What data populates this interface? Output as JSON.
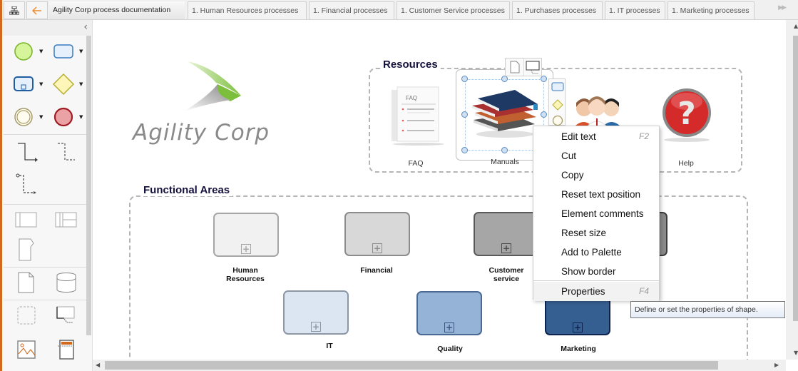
{
  "tabbar": {
    "home_icon": "diagram-tree-icon",
    "back_icon": "arrow-left-icon",
    "tabs": [
      {
        "label": "Agility Corp process documentation",
        "active": true
      },
      {
        "label": "1. Human Resources processes",
        "active": false
      },
      {
        "label": "1. Financial processes",
        "active": false
      },
      {
        "label": "1. Customer Service processes",
        "active": false
      },
      {
        "label": "1. Purchases processes",
        "active": false
      },
      {
        "label": "1. IT processes",
        "active": false
      },
      {
        "label": "1. Marketing processes",
        "active": false
      }
    ],
    "more_icon": "double-chevron-right-icon"
  },
  "palette": {
    "collapse_icon": "chevron-left-icon",
    "items": [
      "start-event",
      "task",
      "subprocess",
      "gateway",
      "intermediate-event",
      "end-event",
      "sequence-flow",
      "message-flow",
      "association",
      "pool",
      "lane-pool",
      "off-page-connector",
      "document",
      "data-store",
      "group",
      "annotation",
      "image",
      "header"
    ]
  },
  "canvas": {
    "logo": {
      "text": "Agility Corp",
      "accent": "#7cbf3c"
    },
    "resources": {
      "title": "Resources",
      "items": [
        {
          "label": "FAQ",
          "icon": "faq-document-icon"
        },
        {
          "label": "Manuals",
          "icon": "books-icon",
          "selected": true
        },
        {
          "label": "",
          "icon": "people-group-icon"
        },
        {
          "label": "Help",
          "icon": "help-question-icon"
        }
      ]
    },
    "functional_areas": {
      "title": "Functional Areas",
      "items": [
        {
          "label_lines": [
            "Human",
            "Resources"
          ],
          "fill": "#f1f1f1",
          "border": "#a6a6a6",
          "plus": "#a6a6a6"
        },
        {
          "label_lines": [
            "Financial",
            ""
          ],
          "fill": "#d8d8d8",
          "border": "#8c8c8c",
          "plus": "#8c8c8c"
        },
        {
          "label_lines": [
            "Customer",
            "service"
          ],
          "fill": "#a6a6a6",
          "border": "#5a5a5a",
          "plus": "#4a4a4a"
        },
        {
          "label_lines": [
            "",
            ""
          ],
          "fill": "#8a8a8a",
          "border": "#3d3d3d",
          "plus": "#333333"
        },
        {
          "label_lines": [
            "IT",
            ""
          ],
          "fill": "#dce6f2",
          "border": "#8c97a6",
          "plus": "#8c97a6"
        },
        {
          "label_lines": [
            "Quality",
            ""
          ],
          "fill": "#95b3d7",
          "border": "#4a6a94",
          "plus": "#3a5580"
        },
        {
          "label_lines": [
            "Marketing",
            ""
          ],
          "fill": "#365f91",
          "border": "#0f2350",
          "plus": "#0f2350"
        }
      ]
    }
  },
  "context_menu": {
    "items": [
      {
        "label": "Edit text",
        "shortcut": "F2"
      },
      {
        "label": "Cut",
        "shortcut": ""
      },
      {
        "label": "Copy",
        "shortcut": ""
      },
      {
        "label": "Reset text position",
        "shortcut": ""
      },
      {
        "label": "Element comments",
        "shortcut": ""
      },
      {
        "label": "Reset size",
        "shortcut": ""
      },
      {
        "label": "Add to Palette",
        "shortcut": ""
      },
      {
        "label": "Show border",
        "shortcut": ""
      },
      {
        "label": "Properties",
        "shortcut": "F4",
        "hovered": true
      }
    ]
  },
  "tooltip": {
    "text": "Define or set the properties of shape."
  }
}
